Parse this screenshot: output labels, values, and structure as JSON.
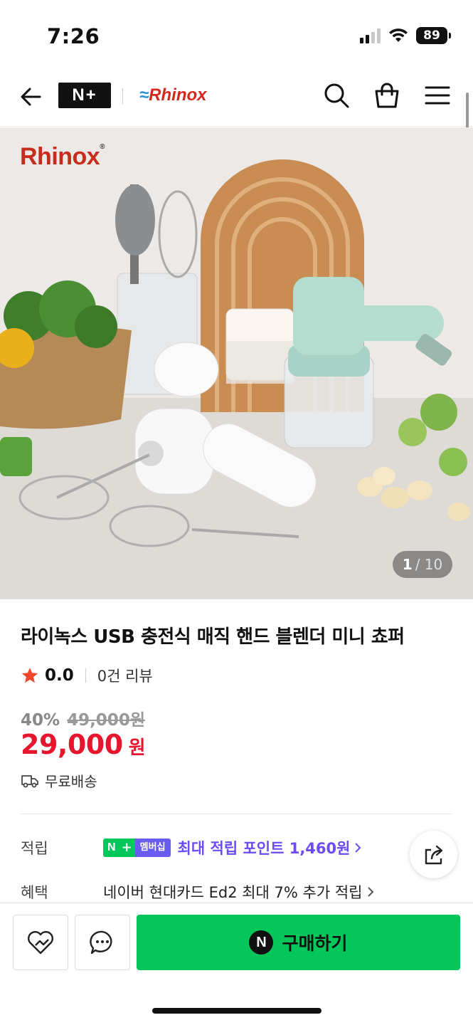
{
  "status_bar": {
    "time": "7:26",
    "battery": "89",
    "icons": [
      "cellular-signal-icon",
      "wifi-icon",
      "battery-icon"
    ]
  },
  "header": {
    "nplus_logo": "N+",
    "brand_logo": "Rhinox",
    "icons": [
      "back-arrow-icon",
      "search-icon",
      "shopping-bag-icon",
      "hamburger-menu-icon"
    ]
  },
  "hero": {
    "brand_text": "Rhinox",
    "counter_current": "1",
    "counter_total": "/ 10"
  },
  "product": {
    "title": "라이녹스 USB 충전식 매직 핸드 블렌더 미니 쵸퍼",
    "rating": "0.0",
    "review_count": "0건 리뷰",
    "discount": "40%",
    "original_price": "49,000원",
    "price": "29,000",
    "price_unit": "원",
    "shipping": "무료배송"
  },
  "details": {
    "points_label": "적립",
    "membership_n": "N",
    "membership_plus": "+",
    "membership_text": "멤버십",
    "points_text": "최대 적립 포인트 1,460원",
    "benefit_label": "혜택",
    "benefit_text": "네이버 현대카드 Ed2 최대 7% 추가 적립"
  },
  "bottom_bar": {
    "buy_label": "구매하기",
    "naver_n": "N"
  },
  "colors": {
    "price_red": "#e5162e",
    "naver_green": "#03c75a",
    "points_purple": "#6b4cf2",
    "brand_red": "#c72c1c"
  }
}
